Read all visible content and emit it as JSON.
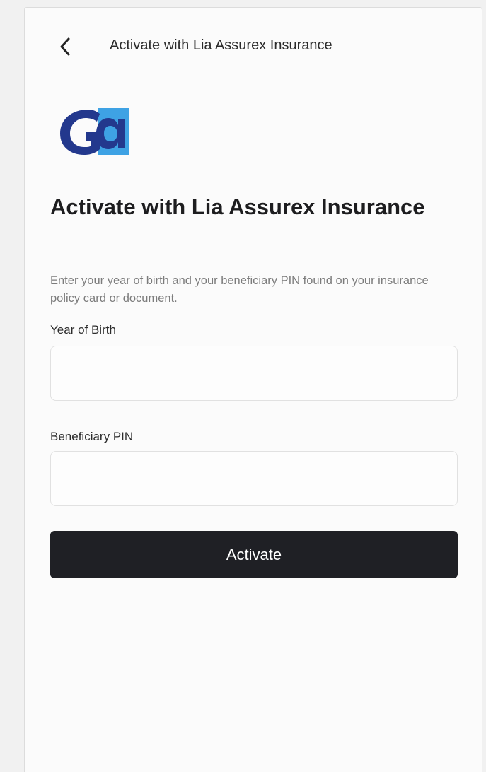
{
  "nav": {
    "title": "Activate with Lia Assurex Insurance"
  },
  "logo": {
    "icon": "ga-logo-icon",
    "colors": {
      "dark": "#23388d",
      "light": "#3ea2e4"
    }
  },
  "heading": "Activate with Lia Assurex Insurance",
  "description": "Enter your year of birth and your beneficiary PIN found on your insurance policy card or document.",
  "form": {
    "year_of_birth": {
      "label": "Year of Birth",
      "value": "",
      "placeholder": ""
    },
    "beneficiary_pin": {
      "label": "Beneficiary PIN",
      "value": "",
      "placeholder": ""
    }
  },
  "activate_button": {
    "label": "Activate",
    "color": "#1f2025"
  }
}
